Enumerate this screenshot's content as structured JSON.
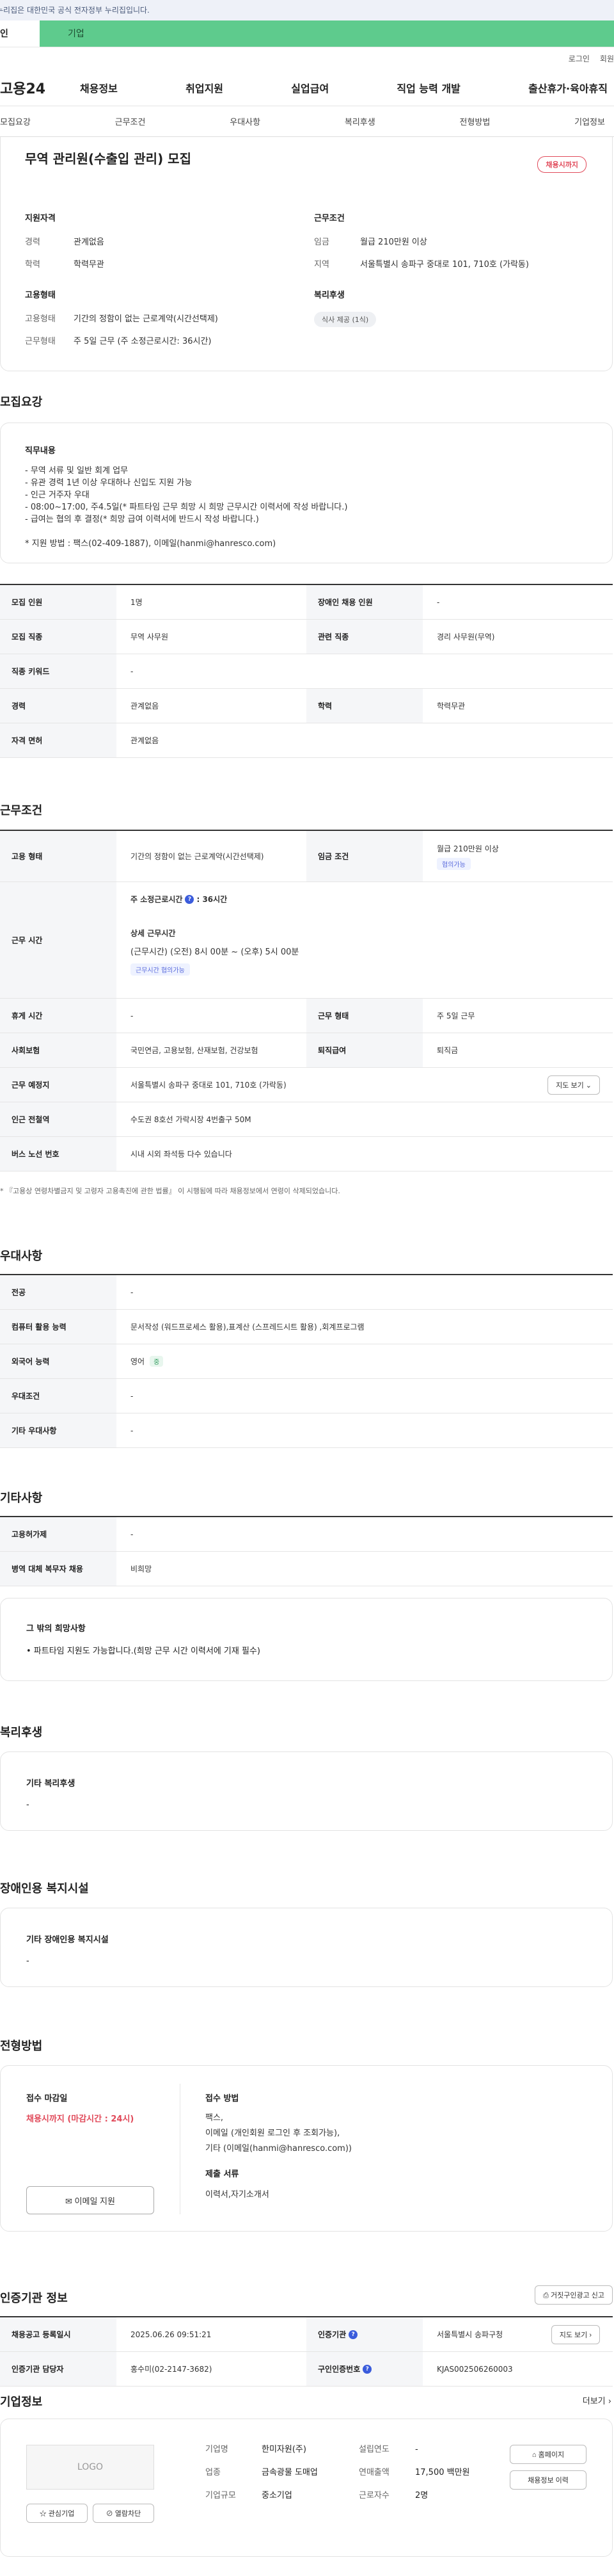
{
  "gov_notice": "누리집은 대한민국 공식 전자정부 누리집입니다.",
  "tabs": [
    "인",
    "기업"
  ],
  "util": [
    "로그인",
    "회원"
  ],
  "logo": "고용24",
  "gnb": [
    "채용정보",
    "취업지원",
    "실업급여",
    "직업 능력 개발",
    "출산휴가·육아휴직"
  ],
  "subnav": [
    "모집요강",
    "근무조건",
    "우대사항",
    "복리후생",
    "전형방법",
    "기업정보"
  ],
  "hero": {
    "title": "무역 관리원(수출입 관리) 모집",
    "badge": "채용시까지",
    "qual_title": "지원자격",
    "qual": [
      {
        "k": "경력",
        "v": "관계없음"
      },
      {
        "k": "학력",
        "v": "학력무관"
      }
    ],
    "cond_title": "근무조건",
    "cond": [
      {
        "k": "임금",
        "v": "월급 210만원 이상"
      },
      {
        "k": "지역",
        "v": "서울특별시 송파구 중대로 101, 710호 (가락동)"
      }
    ],
    "emp_title": "고용형태",
    "emp": [
      {
        "k": "고용형태",
        "v": "기간의 정함이 없는 근로계약(시간선택제)"
      },
      {
        "k": "근무형태",
        "v": "주 5일 근무 (주 소정근로시간: 36시간)"
      }
    ],
    "welfare_title": "복리후생",
    "welfare_pill": "식사 제공 (1식)"
  },
  "recruit": {
    "title": "모집요강",
    "duty_title": "직무내용",
    "duty_lines": [
      "- 무역 서류 및 일반 회계 업무",
      "- 유관 경력 1년 이상 우대하나 신입도 지원 가능",
      "- 인근 거주자 우대",
      "- 08:00~17:00, 주4.5일(* 파트타임 근무 희망 시 희망 근무시간 이력서에 작성 바랍니다.)",
      "- 급여는 협의 후 결정(* 희망 급여 이력서에 반드시 작성 바랍니다.)",
      "",
      "* 지원 방법 : 팩스(02-409-1887), 이메일(hanmi@hanresco.com)"
    ],
    "rows": [
      {
        "k1": "모집 인원",
        "v1": "1명",
        "k2": "장애인 채용 인원",
        "v2": "-"
      },
      {
        "k1": "모집 직종",
        "v1": "무역 사무원",
        "k2": "관련 직종",
        "v2": "경리 사무원(무역)"
      },
      {
        "k1": "직종 키워드",
        "v1": "-"
      },
      {
        "k1": "경력",
        "v1": "관계없음",
        "k2": "학력",
        "v2": "학력무관"
      },
      {
        "k1": "자격 면허",
        "v1": "관계없음"
      }
    ]
  },
  "work": {
    "title": "근무조건",
    "emp_k": "고용 형태",
    "emp_v": "기간의 정함이 없는 근로계약(시간선택제)",
    "wage_k": "임금 조건",
    "wage_v": "월급 210만원 이상",
    "wage_chip": "협의가능",
    "time_k": "근무 시간",
    "time_main": "주 소정근로시간",
    "time_hours": ": 36시간",
    "time_detail_title": "상세 근무시간",
    "time_detail": "(근무시간) (오전) 8시 00분 ~ (오후) 5시 00분",
    "time_chip": "근무시간 협의가능",
    "holiday_k": "휴게 시간",
    "holiday_v": "-",
    "form_k": "근무 형태",
    "form_v": "주 5일 근무",
    "ins_k": "사회보험",
    "ins_v": "국민연금, 고용보험, 산재보험, 건강보험",
    "ret_k": "퇴직급여",
    "ret_v": "퇴직금",
    "place_k": "근무 예정지",
    "place_v": "서울특별시 송파구 중대로 101, 710호 (가락동)",
    "map_btn": "지도 보기",
    "subway_k": "인근 전철역",
    "subway_v": "수도권 8호선 가락시장 4번출구 50M",
    "bus_k": "버스 노선 번호",
    "bus_v": "시내 시외 좌석등 다수 있습니다",
    "note": "* 『고용상 연령차별금지 및 고령자 고용촉진에 관한 법률』 이 시행됨에 따라 채용정보에서 연령이 삭제되었습니다."
  },
  "pref": {
    "title": "우대사항",
    "rows": [
      {
        "k": "전공",
        "v": "-"
      },
      {
        "k": "컴퓨터 활용 능력",
        "v": "문서작성 (워드프로세스 활용),표계산 (스프레드시트 활용) ,회계프로그램"
      },
      {
        "k": "외국어 능력",
        "v": "영어",
        "chip": "중"
      },
      {
        "k": "우대조건",
        "v": "-"
      },
      {
        "k": "기타 우대사항",
        "v": "-"
      }
    ]
  },
  "etc": {
    "title": "기타사항",
    "rows": [
      {
        "k": "고용허가제",
        "v": "-"
      },
      {
        "k": "병역 대체 복무자 채용",
        "v": "비희망"
      }
    ],
    "other_title": "그 밖의 희망사항",
    "other_text": "• 파트타임 지원도 가능합니다.(희망 근무 시간 이력서에 기재 필수)"
  },
  "welfare": {
    "title": "복리후생",
    "box_title": "기타 복리후생",
    "box_text": "-"
  },
  "disabled": {
    "title": "장애인용 복지시설",
    "box_title": "기타 장애인용 복지시설",
    "box_text": "-"
  },
  "process": {
    "title": "전형방법",
    "deadline_title": "접수 마감일",
    "deadline_text": "채용시까지 (마감시간 : 24시)",
    "apply_btn": "이메일 지원",
    "method_title": "접수 방법",
    "method_lines": [
      "팩스,",
      "이메일 (개인회원 로그인 후 조회가능),",
      "기타 (이메일(hanmi@hanresco.com))"
    ],
    "docs_title": "제출 서류",
    "docs_text": "이력서,자기소개서"
  },
  "agency": {
    "title": "인증기관 정보",
    "report_btn": "거짓구인광고 신고",
    "date_k": "채용공고 등록일시",
    "date_v": "2025.06.26 09:51:21",
    "org_k": "인증기관",
    "org_v": "서울특별시 송파구청",
    "map_btn": "지도 보기",
    "mgr_k": "인증기관 담당자",
    "mgr_v": "홍수미(02-2147-3682)",
    "id_k": "구인인증번호",
    "id_v": "KJAS002506260003"
  },
  "company": {
    "title": "기업정보",
    "more": "더보기",
    "logo_text": "LOGO",
    "fav_btn": "관심기업",
    "tag_btn": "열람차단",
    "name_k": "기업명",
    "name_v": "한미자원(주)",
    "ind_k": "업종",
    "ind_v": "금속광물 도매업",
    "size_k": "기업규모",
    "size_v": "중소기업",
    "year_k": "설립연도",
    "year_v": "-",
    "sales_k": "연매출액",
    "sales_v": "17,500 백만원",
    "emp_k": "근로자수",
    "emp_v": "2명",
    "home_btn": "홈페이지",
    "jobs_btn": "채용정보 이력"
  }
}
